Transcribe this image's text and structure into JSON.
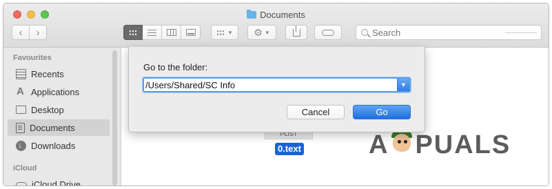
{
  "window": {
    "title": "Documents"
  },
  "toolbar": {
    "back_icon": "chevron-left-icon",
    "forward_icon": "chevron-right-icon",
    "views": [
      "icon-view",
      "list-view",
      "column-view",
      "cover-flow-view"
    ],
    "active_view": "icon-view",
    "search_placeholder": "Search"
  },
  "sidebar": {
    "favourites_header": "Favourites",
    "items": [
      {
        "label": "Recents",
        "icon": "recents-icon"
      },
      {
        "label": "Applications",
        "icon": "applications-icon"
      },
      {
        "label": "Desktop",
        "icon": "desktop-icon"
      },
      {
        "label": "Documents",
        "icon": "documents-icon",
        "selected": true
      },
      {
        "label": "Downloads",
        "icon": "downloads-icon"
      }
    ],
    "icloud_header": "iCloud",
    "icloud_items": [
      {
        "label": "iCloud Drive",
        "icon": "cloud-icon"
      }
    ]
  },
  "content": {
    "file_thumb_text": "PLIST",
    "file_name": "0.text",
    "watermark": {
      "left": "A",
      "right": "PUALS"
    }
  },
  "dialog": {
    "label": "Go to the folder:",
    "path_value": "/Users/Shared/SC Info",
    "cancel_label": "Cancel",
    "go_label": "Go"
  },
  "colors": {
    "accent": "#1f6fe0",
    "selection": "#1a62d9",
    "close": "#ee6a5f",
    "minimize": "#f5bf4f",
    "maximize": "#61c554"
  }
}
